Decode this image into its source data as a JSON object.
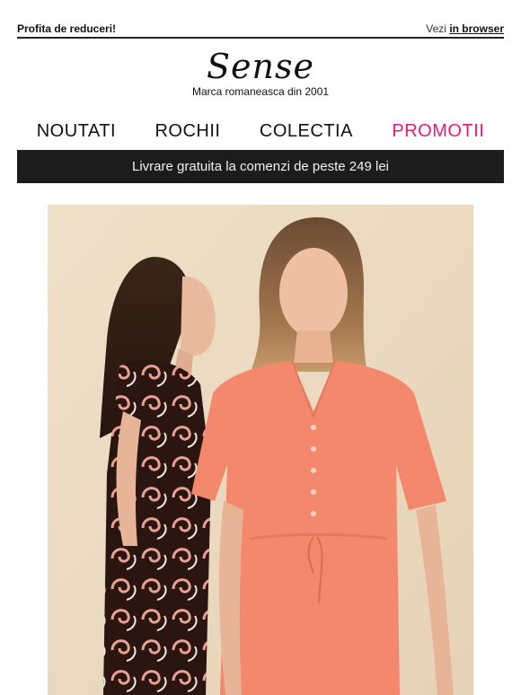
{
  "topbar": {
    "left_text": "Profita de reduceri!",
    "right_prefix": "Vezi",
    "right_link": "in browser"
  },
  "brand": {
    "logo_text": "Sense",
    "tagline": "Marca romaneasca din 2001"
  },
  "nav": {
    "items": [
      {
        "label": "NOUTATI"
      },
      {
        "label": "ROCHII"
      },
      {
        "label": "COLECTIA"
      },
      {
        "label": "PROMOTII"
      }
    ],
    "accent_color": "#e6197a"
  },
  "banner": {
    "text": "Livrare gratuita la comenzi de peste 249 lei",
    "background": "#1c1c1c"
  },
  "hero": {
    "image_icon": "fashion-photo",
    "dress_colors": {
      "coral": "#f4886d",
      "print_base": "#2a1510",
      "print_accent": "#e9a191"
    }
  }
}
